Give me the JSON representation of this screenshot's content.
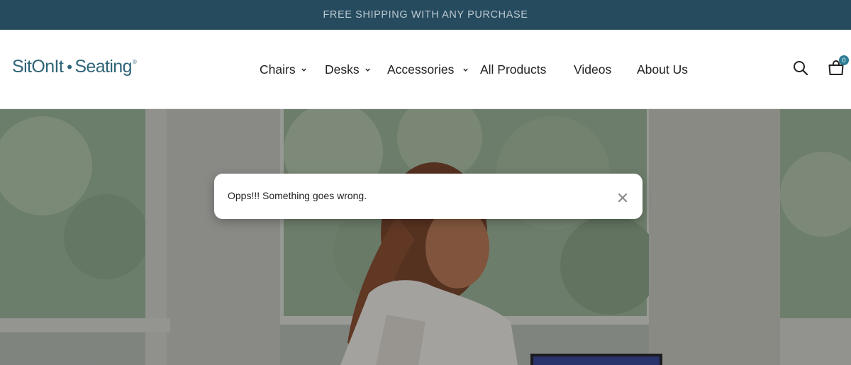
{
  "announcement": "FREE SHIPPING WITH ANY PURCHASE",
  "logo": {
    "word1": "SitOnIt",
    "dot": "•",
    "word2": "Seating",
    "reg": "®"
  },
  "nav": {
    "items": [
      {
        "label": "Chairs"
      },
      {
        "label": "Desks"
      },
      {
        "label": "Accessories"
      },
      {
        "label": "All Products"
      },
      {
        "label": "Videos"
      },
      {
        "label": "About Us"
      }
    ]
  },
  "cart": {
    "count": "0"
  },
  "icons": {
    "search": "search-icon",
    "cart": "shopping-bag-icon",
    "close": "close-icon",
    "dropdown": "chevron-down-icon"
  },
  "toast": {
    "message": "Opps!!! Something goes wrong."
  },
  "colors": {
    "announcement_bg": "#274b5e",
    "brand": "#2e6478",
    "badge": "#2e7d94"
  }
}
